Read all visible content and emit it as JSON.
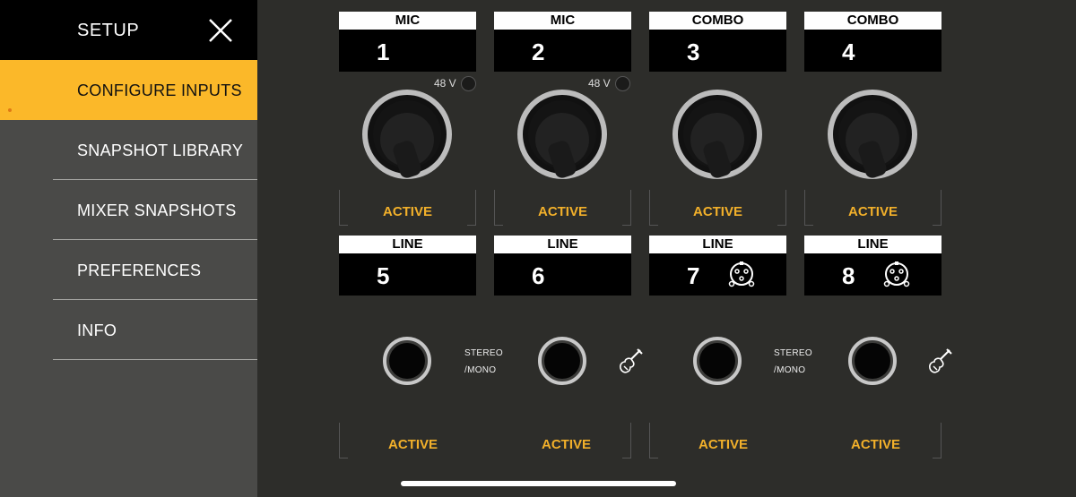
{
  "sidebar": {
    "title": "SETUP",
    "close_icon": "close-icon",
    "items": [
      {
        "label": "CONFIGURE INPUTS",
        "active": true
      },
      {
        "label": "SNAPSHOT LIBRARY",
        "active": false
      },
      {
        "label": "MIXER SNAPSHOTS",
        "active": false
      },
      {
        "label": "PREFERENCES",
        "active": false
      },
      {
        "label": "INFO",
        "active": false
      }
    ]
  },
  "channels_top": [
    {
      "type": "MIC",
      "number": "1",
      "phantom": "48 V",
      "status": "ACTIVE"
    },
    {
      "type": "MIC",
      "number": "2",
      "phantom": "48 V",
      "status": "ACTIVE"
    },
    {
      "type": "COMBO",
      "number": "3",
      "status": "ACTIVE"
    },
    {
      "type": "COMBO",
      "number": "4",
      "status": "ACTIVE"
    }
  ],
  "channels_bottom": [
    {
      "type": "LINE",
      "number": "5"
    },
    {
      "type": "LINE",
      "number": "6"
    },
    {
      "type": "LINE",
      "number": "7",
      "icon": "xlr-connector-icon"
    },
    {
      "type": "LINE",
      "number": "8",
      "icon": "xlr-connector-icon"
    }
  ],
  "jack_modes": {
    "stereo_mono_1": "STEREO",
    "stereo_mono_1b": "/MONO",
    "stereo_mono_2": "STEREO",
    "stereo_mono_2b": "/MONO",
    "guitar_icon": "guitar-icon"
  },
  "bottom_status": [
    "ACTIVE",
    "ACTIVE",
    "ACTIVE",
    "ACTIVE"
  ],
  "colors": {
    "accent": "#fbb829",
    "status_text": "#f2b02a",
    "sidebar_bg": "#4a4a48",
    "main_bg": "#2d2d2a"
  }
}
